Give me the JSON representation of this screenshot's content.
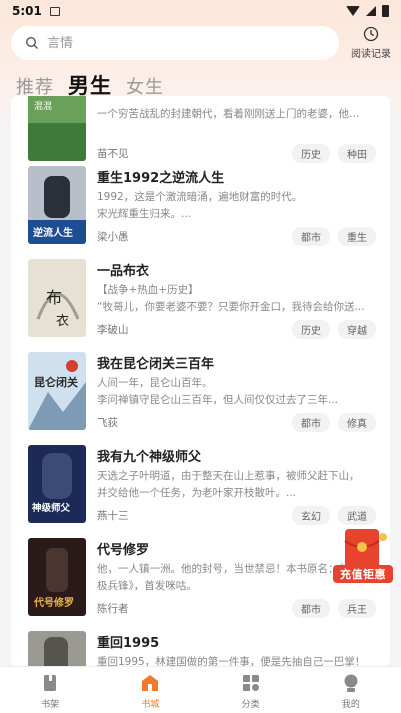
{
  "status_bar": {
    "time": "5:01"
  },
  "search": {
    "placeholder": "言情"
  },
  "history": {
    "label": "阅读记录"
  },
  "gender_tabs": [
    {
      "label": "推荐",
      "active": false
    },
    {
      "label": "男生",
      "active": true
    },
    {
      "label": "女生",
      "active": false
    }
  ],
  "books": [
    {
      "title": "",
      "desc": [
        "一个穷苦战乱的封建朝代，看着刚刚送上门的老婆，他决..."
      ],
      "author": "苗不见",
      "tags": [
        "历史",
        "种田"
      ]
    },
    {
      "title": "重生1992之逆流人生",
      "desc": [
        "1992，这是个激流暗涌，遍地财富的时代。",
        "宋光辉重生归来。..."
      ],
      "author": "梁小愚",
      "tags": [
        "都市",
        "重生"
      ]
    },
    {
      "title": "一品布衣",
      "desc": [
        "【战争+热血+历史】",
        "“牧哥儿，你要老婆不要？只要你开金口，我待会给你送..."
      ],
      "author": "李破山",
      "tags": [
        "历史",
        "穿越"
      ]
    },
    {
      "title": "我在昆仑闭关三百年",
      "desc": [
        "人间一年，昆仑山百年。",
        "李问禅镇守昆仑山三百年，但人间仅仅过去了三年..."
      ],
      "author": "飞荻",
      "tags": [
        "都市",
        "修真"
      ]
    },
    {
      "title": "我有九个神级师父",
      "desc": [
        "天选之子叶明道，由于整天在山上惹事，被师父赶下山，",
        "并交给他一个任务，为老叶家开枝散叶。..."
      ],
      "author": "燕十三",
      "tags": [
        "玄幻",
        "武道"
      ]
    },
    {
      "title": "代号修罗",
      "desc": [
        "他，一人镇一洲。他的封号，当世禁忌！本书原名：《",
        "极兵锋》，首发咪咕。"
      ],
      "author": "陈行者",
      "tags": [
        "都市",
        "兵王"
      ]
    },
    {
      "title": "重回1995",
      "desc": [
        "重回1995，林建国做的第一件事，便是先抽自己一巴掌！"
      ],
      "author": "",
      "tags": []
    }
  ],
  "promo": {
    "label": "充值钜惠"
  },
  "nav": [
    {
      "label": "书架",
      "icon": "bookshelf-icon",
      "active": false
    },
    {
      "label": "书城",
      "icon": "store-icon",
      "active": true
    },
    {
      "label": "分类",
      "icon": "category-icon",
      "active": false
    },
    {
      "label": "我的",
      "icon": "profile-icon",
      "active": false
    }
  ],
  "colors": {
    "accent": "#f07a2a",
    "promo_red": "#e8432f"
  }
}
